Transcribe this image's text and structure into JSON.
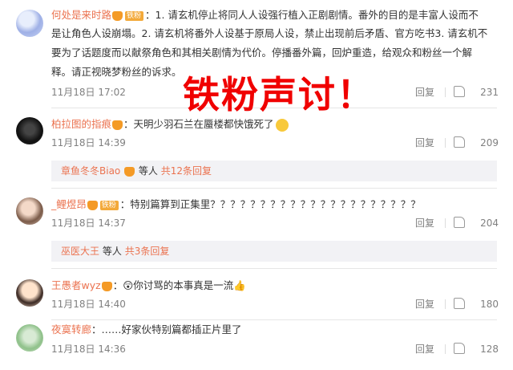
{
  "overlay_text": "铁粉声讨！",
  "reply_label": "回复",
  "comments": [
    {
      "user": "何处是来时路",
      "badge": "铁粉",
      "lines": [
        "：1. 请玄机停止将同人人设强行植入正剧剧情。番外的目的是丰富人设而不",
        "是让角色人设崩塌。2. 请玄机将番外人设基于原局人设，禁止出现前后矛盾、官方吃书3. 请玄机不",
        "要为了话题度而以献祭角色和其相关剧情为代价。停播番外篇，回炉重造，给观众和粉丝一个解",
        "释。请正视晓梦粉丝的诉求。"
      ],
      "time": "11月18日 17:02",
      "likes": "231"
    },
    {
      "user": "柏拉图的指痕",
      "text": "：天明少羽石兰在蜃楼都快饿死了",
      "time": "11月18日 14:39",
      "likes": "209",
      "replies": {
        "name": "章鱼冬冬Biao",
        "suffix": "等人",
        "total": "共12条回复"
      }
    },
    {
      "user": "_鲤煜昂",
      "badge": "铁粉",
      "text": "：特别篇算到正集里？？？？？？？？？？？？？？？？？？？？？",
      "time": "11月18日 14:37",
      "likes": "204",
      "replies": {
        "name": "巫医大王",
        "suffix": "等人",
        "total": "共3条回复"
      }
    },
    {
      "user": "王愚者wyz",
      "text": "：😲你讨骂的本事真是一流👍",
      "time": "11月18日 14:40",
      "likes": "180"
    },
    {
      "user": "夜寞转廊",
      "text": "：……好家伙特别篇都插正片里了",
      "time": "11月18日 14:36",
      "likes": "128"
    }
  ]
}
